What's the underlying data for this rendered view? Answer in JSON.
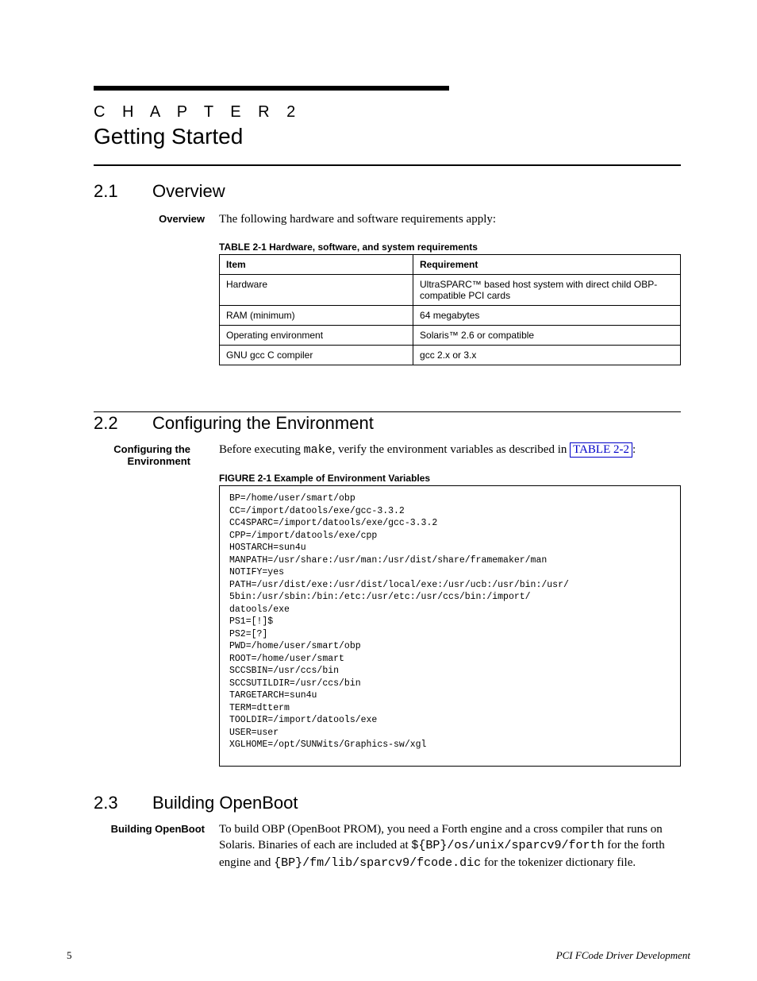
{
  "chapter": {
    "kicker": "C H A P T E R   2",
    "title": "Getting Started"
  },
  "sections": {
    "overview": {
      "num": "2.1",
      "title": "Overview",
      "label": "Overview",
      "intro": "The following hardware and software requirements apply:",
      "table_caption": "TABLE 2-1   Hardware, software, and system requirements",
      "table": {
        "headers": [
          "Item",
          "Requirement"
        ],
        "rows": [
          [
            "Hardware",
            "UltraSPARC™ based host system with direct child OBP-compatible PCI cards"
          ],
          [
            "RAM (minimum)",
            "64 megabytes"
          ],
          [
            "Operating environment",
            "Solaris™ 2.6 or compatible"
          ],
          [
            "GNU gcc C compiler",
            "gcc 2.x or 3.x"
          ]
        ]
      }
    },
    "config": {
      "num": "2.2",
      "title": "Configuring the Environment",
      "label": "Configuring the Environment",
      "para_pre": "Before executing ",
      "para_code": "make",
      "para_mid": ", verify the environment variables as described in ",
      "xref_label": "TABLE 2-2",
      "para_post": ":",
      "fig_caption": "FIGURE 2-1  Example of Environment Variables",
      "env_lines": [
        "BP=/home/user/smart/obp",
        "CC=/import/datools/exe/gcc-3.3.2",
        "CC4SPARC=/import/datools/exe/gcc-3.3.2",
        "CPP=/import/datools/exe/cpp",
        "HOSTARCH=sun4u",
        "MANPATH=/usr/share:/usr/man:/usr/dist/share/framemaker/man",
        "NOTIFY=yes",
        "PATH=/usr/dist/exe:/usr/dist/local/exe:/usr/ucb:/usr/bin:/usr/",
        "5bin:/usr/sbin:/bin:/etc:/usr/etc:/usr/ccs/bin:/import/",
        "datools/exe",
        "PS1=[!]$",
        "PS2=[?]",
        "PWD=/home/user/smart/obp",
        "ROOT=/home/user/smart",
        "SCCSBIN=/usr/ccs/bin",
        "SCCSUTILDIR=/usr/ccs/bin",
        "TARGETARCH=sun4u",
        "TERM=dtterm",
        "TOOLDIR=/import/datools/exe",
        "USER=user",
        "XGLHOME=/opt/SUNWits/Graphics-sw/xgl"
      ]
    },
    "build": {
      "num": "2.3",
      "title": "Building OpenBoot",
      "label": "Building OpenBoot",
      "para_pre": "To build OBP (OpenBoot PROM), you need a Forth engine and a cross compiler that runs on Solaris. Binaries of each are included at ",
      "code1": "${BP}/os/unix/sparcv9/forth",
      "para_mid": " for the forth engine and ",
      "code2": "{BP}/fm/lib/sparcv9/fcode.dic",
      "para_end": " for the tokenizer dictionary file."
    }
  },
  "footer": {
    "page": "5",
    "title": "PCI FCode Driver Development"
  }
}
